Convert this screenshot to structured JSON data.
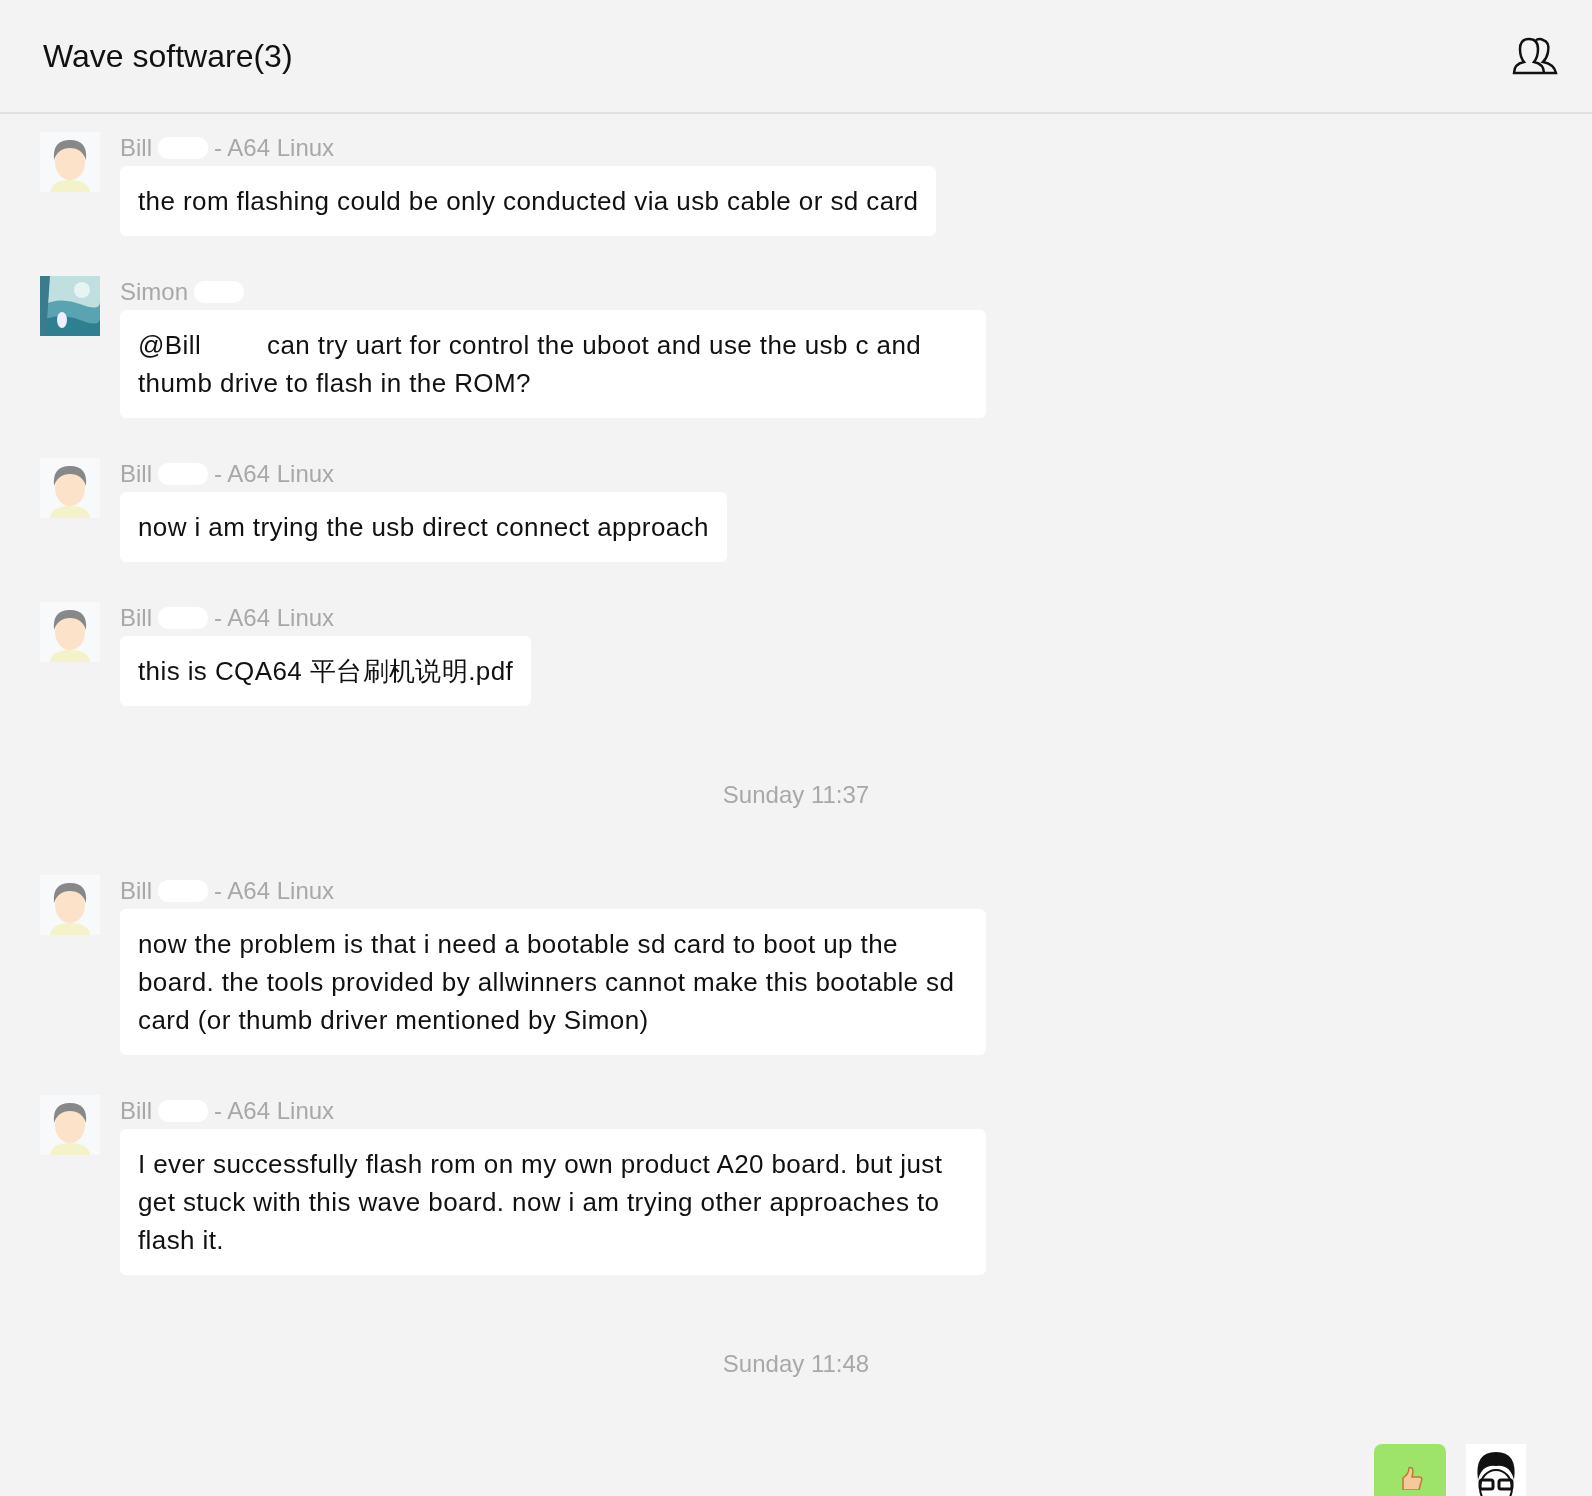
{
  "window": {
    "title": "Wave software(3)"
  },
  "messages": [
    {
      "kind": "message",
      "avatar": {
        "kind": "cartoon"
      },
      "sender": "Bill",
      "redacted": true,
      "suffix": "- A64 Linux",
      "text": "the rom flashing could be only conducted via usb cable or sd card"
    },
    {
      "kind": "message",
      "avatar": {
        "kind": "painting"
      },
      "sender": "Simon",
      "redacted": true,
      "mention": "@Bill",
      "text": "can try uart for control the uboot and use the usb c and thumb drive to flash in the ROM?"
    },
    {
      "kind": "message",
      "avatar": {
        "kind": "cartoon"
      },
      "sender": "Bill",
      "redacted": true,
      "suffix": "- A64 Linux",
      "text": "now i am trying the usb direct connect approach"
    },
    {
      "kind": "message",
      "avatar": {
        "kind": "cartoon"
      },
      "sender": "Bill",
      "redacted": true,
      "suffix": "- A64 Linux",
      "text": "this is CQA64 平台刷机说明.pdf"
    },
    {
      "kind": "time",
      "text": "Sunday 11:37"
    },
    {
      "kind": "message",
      "avatar": {
        "kind": "cartoon"
      },
      "sender": "Bill",
      "redacted": true,
      "suffix": "- A64 Linux",
      "text": "now the problem is that i need a bootable sd card to boot up the board. the tools provided by allwinners cannot make this bootable sd card (or thumb driver mentioned by Simon)"
    },
    {
      "kind": "message",
      "avatar": {
        "kind": "cartoon"
      },
      "sender": "Bill",
      "redacted": true,
      "suffix": "- A64 Linux",
      "text": "I ever successfully flash rom on my own product A20 board. but just get stuck with this wave board. now i am trying other approaches to flash it."
    },
    {
      "kind": "time",
      "text": "Sunday 11:48"
    },
    {
      "kind": "sticker",
      "avatar": {
        "kind": "glasses"
      }
    }
  ]
}
